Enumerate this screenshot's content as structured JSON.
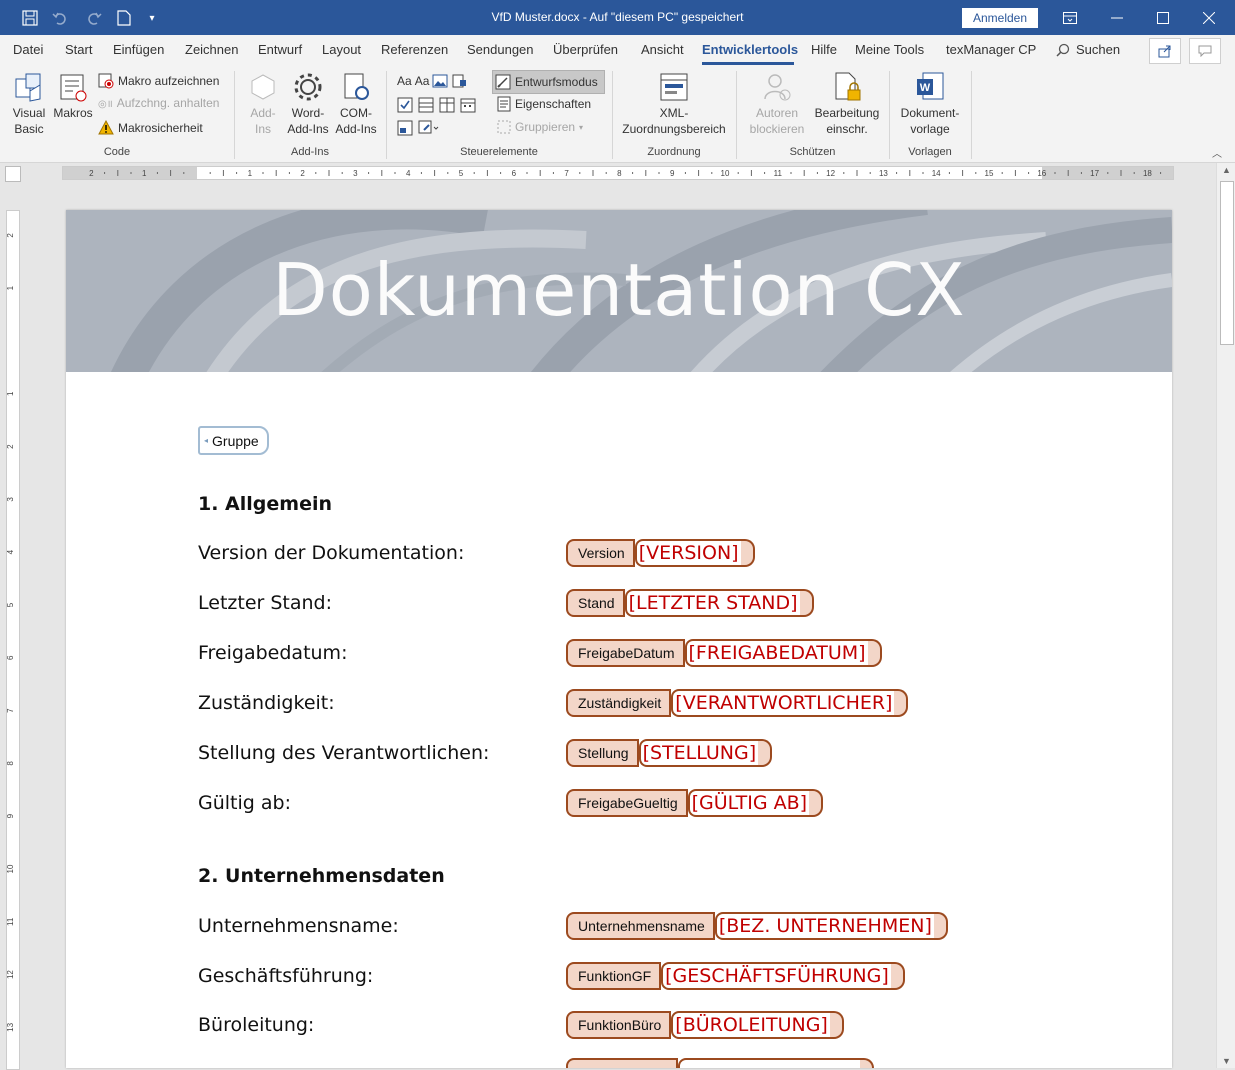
{
  "title_bar": {
    "document_title": "VfD Muster.docx  -  Auf \"diesem PC\" gespeichert",
    "sign_in_label": "Anmelden",
    "icons": [
      "save-icon",
      "undo-icon",
      "redo-icon",
      "new-document-icon",
      "customize-qat-icon",
      "ribbon-display-icon",
      "minimize-icon",
      "maximize-icon",
      "close-icon"
    ]
  },
  "menu": {
    "tabs": [
      "Datei",
      "Start",
      "Einfügen",
      "Zeichnen",
      "Entwurf",
      "Layout",
      "Referenzen",
      "Sendungen",
      "Überprüfen",
      "Ansicht",
      "Entwicklertools",
      "Hilfe",
      "Meine Tools",
      "texManager CP"
    ],
    "active_tab": "Entwicklertools",
    "search_label": "Suchen"
  },
  "ribbon": {
    "code": {
      "label": "Code",
      "visual_basic": "Visual Basic",
      "macros": "Makros",
      "record_macro": "Makro aufzeichnen",
      "pause_recording": "Aufzchng. anhalten",
      "macro_security": "Makrosicherheit"
    },
    "addins": {
      "label": "Add-Ins",
      "addins": "Add-Ins",
      "word_addins": "Word-Add-Ins",
      "com_addins": "COM-Add-Ins"
    },
    "controls": {
      "label": "Steuerelemente",
      "design_mode": "Entwurfsmodus",
      "properties": "Eigenschaften",
      "group": "Gruppieren"
    },
    "mapping": {
      "label": "Zuordnung",
      "xml_pane": "XML-Zuordnungsbereich"
    },
    "protect": {
      "label": "Schützen",
      "block_authors": "Autoren blockieren",
      "restrict_editing": "Bearbeitung einschr."
    },
    "templates": {
      "label": "Vorlagen",
      "document_template": "Dokument-vorlage"
    }
  },
  "ruler": {
    "h_ticks": [
      "2",
      "1",
      "1",
      "2",
      "3",
      "4",
      "5",
      "6",
      "7",
      "8",
      "9",
      "10",
      "11",
      "12",
      "13",
      "14",
      "15",
      "16",
      "17",
      "18"
    ],
    "v_ticks": [
      "2",
      "1",
      "1",
      "2",
      "3",
      "4",
      "5",
      "6",
      "7",
      "8",
      "9",
      "10",
      "11",
      "12",
      "13"
    ]
  },
  "document": {
    "banner_title": "Dokumentation CX",
    "group_control": "Gruppe",
    "section1": {
      "heading": "1.   Allgemein",
      "fields": [
        {
          "label": "Version der Dokumentation:",
          "tag": "Version",
          "value": "[VERSION]"
        },
        {
          "label": "Letzter Stand:",
          "tag": "Stand",
          "value": "[LETZTER STAND]"
        },
        {
          "label": "Freigabedatum:",
          "tag": "FreigabeDatum",
          "value": "[FREIGABEDATUM]"
        },
        {
          "label": "Zuständigkeit:",
          "tag": "Zuständigkeit",
          "value": "[VERANTWORTLICHER]"
        },
        {
          "label": "Stellung des Verantwortlichen:",
          "tag": "Stellung",
          "value": "[STELLUNG]"
        },
        {
          "label": "Gültig ab:",
          "tag": "FreigabeGueltig",
          "value": "[GÜLTIG AB]"
        }
      ]
    },
    "section2": {
      "heading": "2.   Unternehmensdaten",
      "fields": [
        {
          "label": "Unternehmensname:",
          "tag": "Unternehmensname",
          "value": "[BEZ. UNTERNEHMEN]"
        },
        {
          "label": "Geschäftsführung:",
          "tag": "FunktionGF",
          "value": "[GESCHÄFTSFÜHRUNG]"
        },
        {
          "label": "Büroleitung:",
          "tag": "FunktionBüro",
          "value": "[BÜROLEITUNG]"
        }
      ]
    }
  },
  "colors": {
    "title_bar": "#2b579a",
    "control_tag_fill": "#f3d6c8",
    "control_border": "#9c4a1f",
    "placeholder_text": "#c00000"
  }
}
